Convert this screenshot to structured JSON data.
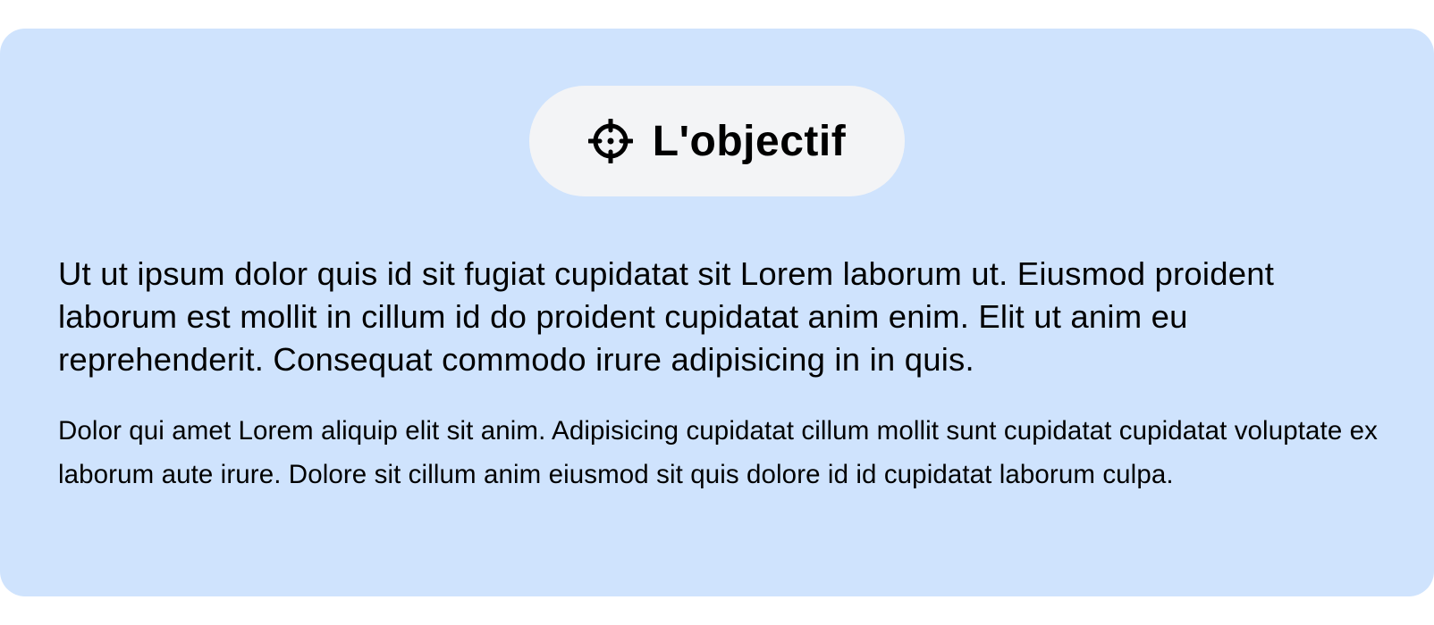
{
  "card": {
    "background_color": "#cfe3fd"
  },
  "badge": {
    "icon": "crosshair-icon",
    "label": "L'objectif",
    "background_color": "#f3f4f6"
  },
  "content": {
    "lead": "Ut ut ipsum dolor quis id sit fugiat cupidatat sit Lorem laborum ut. Eiusmod proident laborum est mollit in cillum id do proident cupidatat anim enim. Elit ut anim eu reprehenderit. Consequat commodo irure adipisicing in in quis.",
    "body": "Dolor qui amet Lorem aliquip elit sit anim. Adipisicing cupidatat cillum mollit sunt cupidatat cupidatat voluptate ex laborum aute irure. Dolore sit cillum anim eiusmod sit quis dolore id id cupidatat laborum culpa."
  }
}
